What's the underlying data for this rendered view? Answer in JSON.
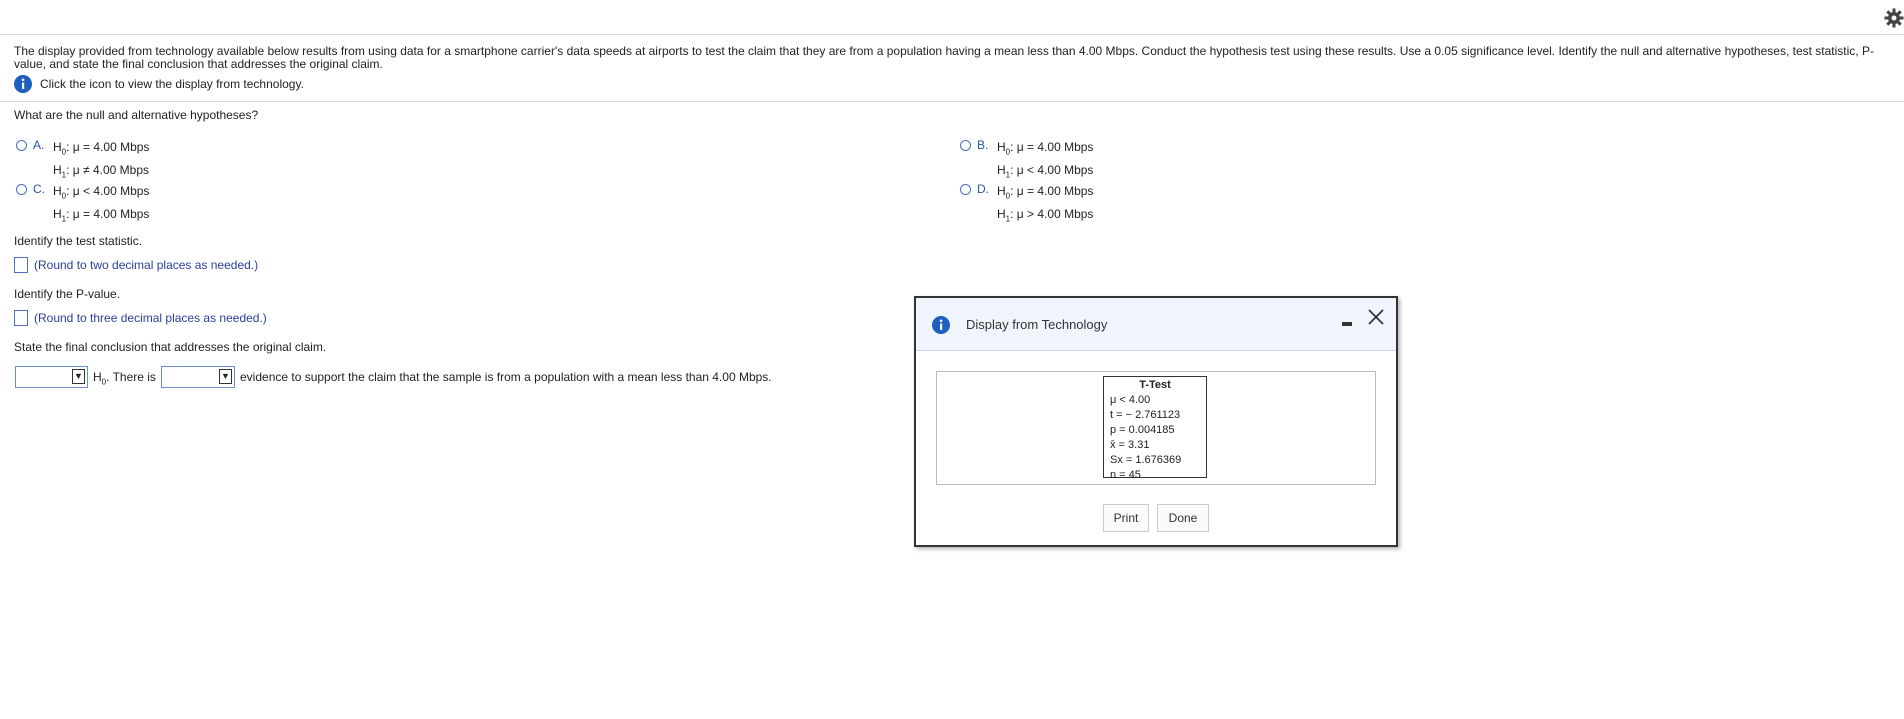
{
  "prompt": "The display provided from technology available below results from using data for a smartphone carrier's data speeds at airports to test the claim that they are from a population having a mean less than 4.00 Mbps. Conduct the hypothesis test using these results. Use a 0.05 significance level. Identify the null and alternative hypotheses, test statistic, P-value, and state the final conclusion that addresses the original claim.",
  "info_link": "Click the icon to view the display from technology.",
  "q1": "What are the null and alternative hypotheses?",
  "options": [
    {
      "letter": "A.",
      "h0_rel": ": μ = 4.00 Mbps",
      "h1_rel": ": μ ≠ 4.00 Mbps"
    },
    {
      "letter": "B.",
      "h0_rel": ": μ = 4.00 Mbps",
      "h1_rel": ": μ < 4.00 Mbps"
    },
    {
      "letter": "C.",
      "h0_rel": ": μ < 4.00 Mbps",
      "h1_rel": ": μ = 4.00 Mbps"
    },
    {
      "letter": "D.",
      "h0_rel": ": μ = 4.00 Mbps",
      "h1_rel": ": μ > 4.00 Mbps"
    }
  ],
  "q2": "Identify the test statistic.",
  "hint2": "(Round to two decimal places as needed.)",
  "q3": "Identify the P-value.",
  "hint3": "(Round to three decimal places as needed.)",
  "q4": "State the final conclusion that addresses the original claim.",
  "conclusion": {
    "h0_prefix": "H",
    "h0_suffix": ". There is",
    "tail": "evidence to support the claim that the sample is from a population with a mean less than 4.00 Mbps."
  },
  "dialog": {
    "title": "Display from Technology",
    "ttest": {
      "title": "T-Test",
      "lines": [
        "μ < 4.00",
        "t = − 2.761123",
        "p = 0.004185",
        "x̄ = 3.31",
        "Sx = 1.676369",
        "n = 45"
      ]
    },
    "print_label": "Print",
    "done_label": "Done"
  },
  "colors": {
    "accent": "#2b55a8",
    "hint": "#2b3f9e",
    "info": "#1f5fbf"
  },
  "icons": [
    "gear-icon",
    "info-icon",
    "minimize-icon",
    "close-icon"
  ]
}
